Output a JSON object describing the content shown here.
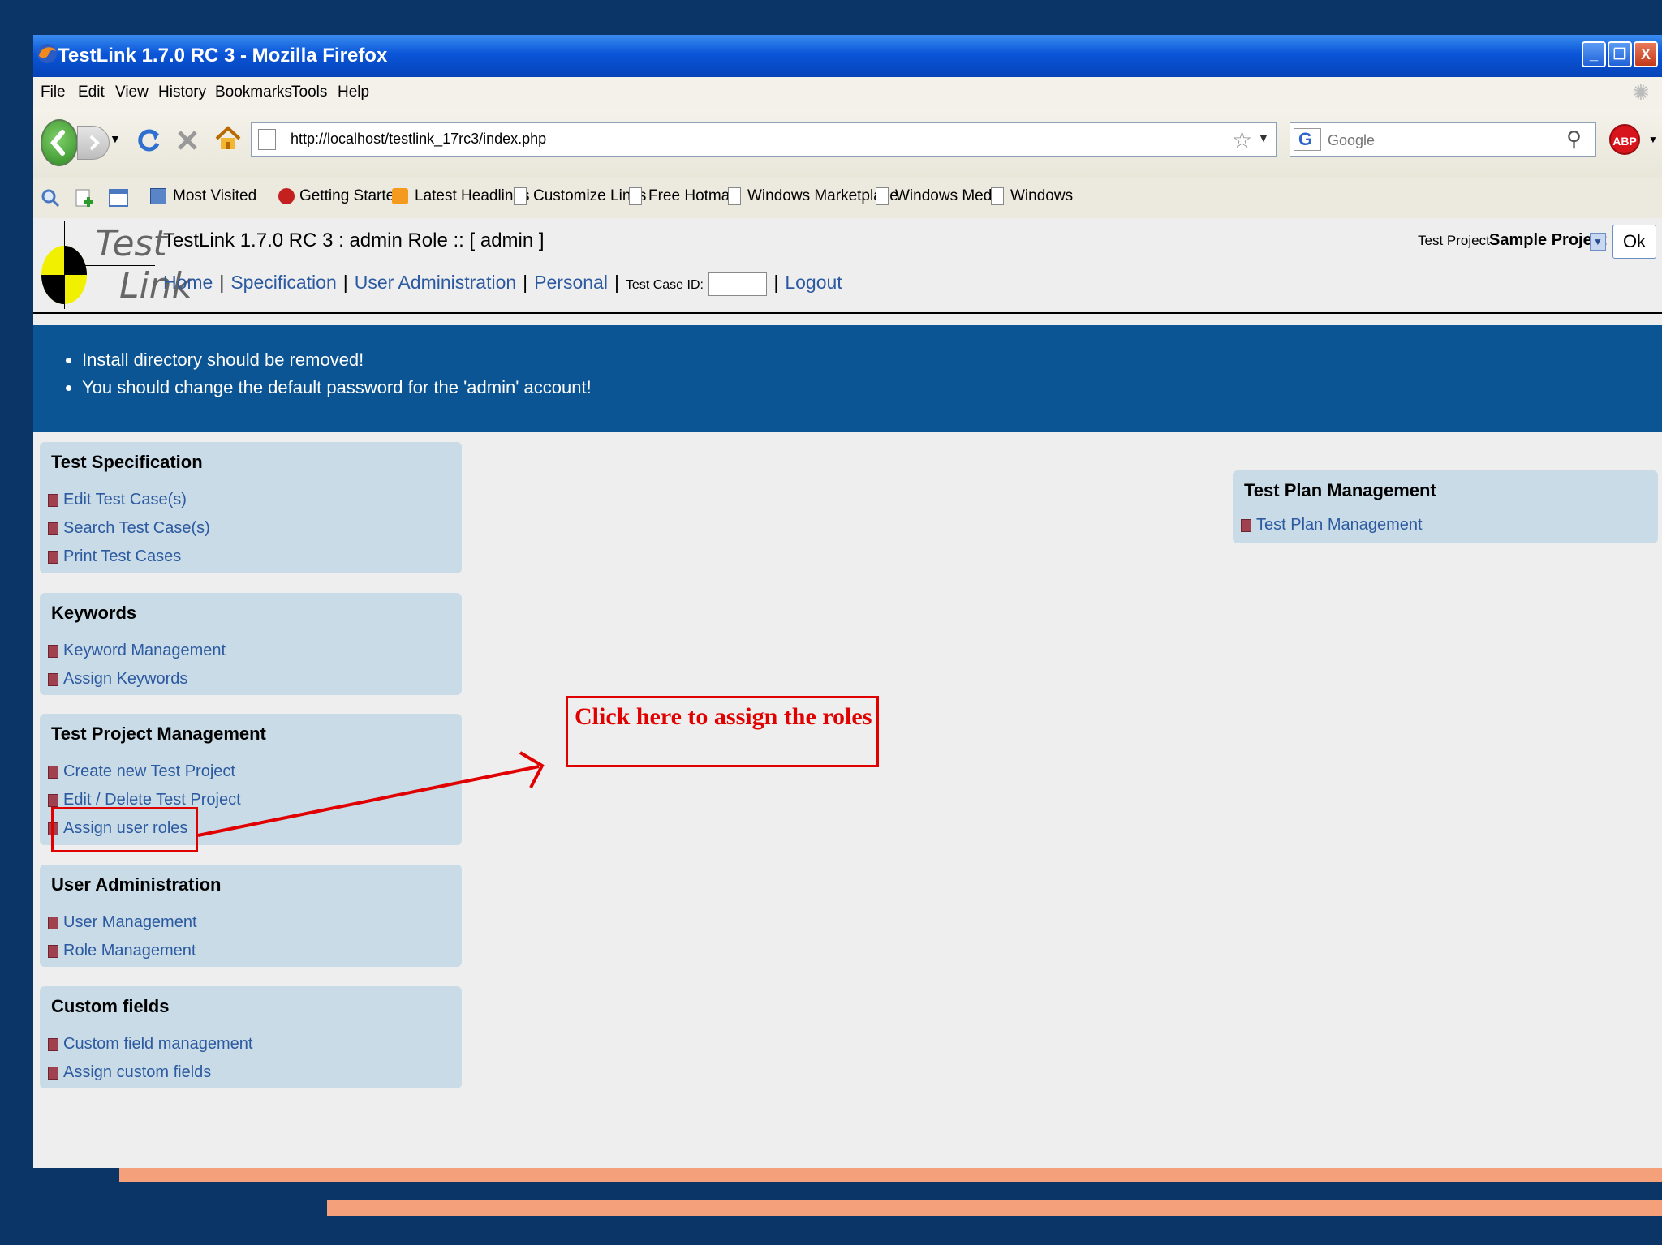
{
  "window": {
    "title": "TestLink 1.7.0 RC 3 - Mozilla Firefox"
  },
  "menu": [
    "File",
    "Edit",
    "View",
    "History",
    "Bookmarks",
    "Tools",
    "Help"
  ],
  "toolbar": {
    "url": "http://localhost/testlink_17rc3/index.php",
    "search_placeholder": "Google",
    "abp_label": "ABP"
  },
  "bookmarks": [
    "Most Visited",
    "Getting Started",
    "Latest Headlines",
    "Customize Links",
    "Free Hotmail",
    "Windows Marketplace",
    "Windows Media",
    "Windows"
  ],
  "testlink": {
    "logo_top": "Test",
    "logo_bottom": "Link",
    "title": "TestLink 1.7.0 RC 3 : admin Role :: [ admin ]",
    "project_label": "Test Project",
    "project_name": "Sample Project",
    "ok_label": "Ok",
    "nav": {
      "home": "Home",
      "specification": "Specification",
      "user_admin": "User Administration",
      "personal": "Personal",
      "test_case_id": "Test Case ID:",
      "logout": "Logout"
    }
  },
  "warnings": [
    "Install directory should be removed!",
    "You should change the default password for the 'admin' account!"
  ],
  "panels": {
    "test_spec": {
      "title": "Test Specification",
      "items": [
        "Edit Test Case(s)",
        "Search Test Case(s)",
        "Print Test Cases"
      ]
    },
    "keywords": {
      "title": "Keywords",
      "items": [
        "Keyword Management",
        "Assign Keywords"
      ]
    },
    "project_mgmt": {
      "title": "Test Project Management",
      "items": [
        "Create new Test Project",
        "Edit / Delete Test Project",
        "Assign user roles"
      ]
    },
    "user_admin": {
      "title": "User Administration",
      "items": [
        "User Management",
        "Role Management"
      ]
    },
    "custom_fields": {
      "title": "Custom fields",
      "items": [
        "Custom field management",
        "Assign custom fields"
      ]
    },
    "test_plan": {
      "title": "Test Plan Management",
      "items": [
        "Test Plan Management"
      ]
    }
  },
  "annotation": {
    "callout_text": "Click here to assign the roles",
    "color": "#e00000"
  },
  "colors": {
    "slide_bg": "#0b3566",
    "stripe": "#f4a07a",
    "banner": "#0b5594",
    "panel": "#c9dbe7",
    "link": "#2c5aa0"
  }
}
